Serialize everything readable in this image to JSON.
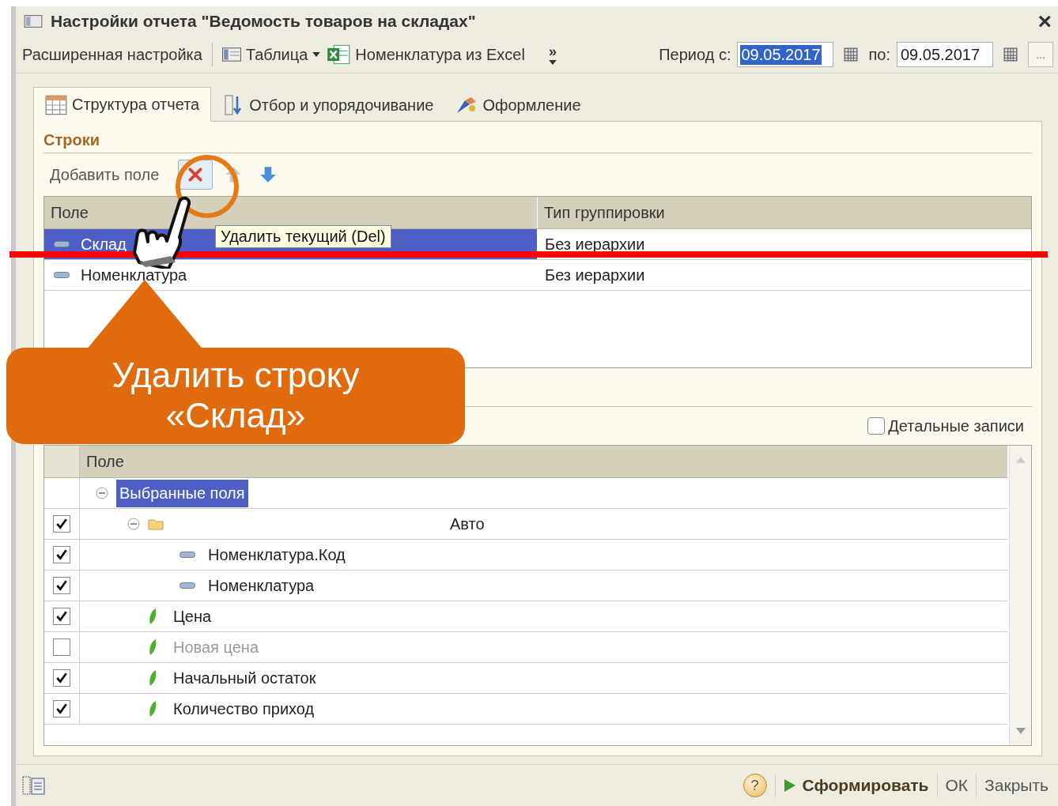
{
  "window": {
    "title": "Настройки отчета \"Ведомость товаров на складах\"",
    "close": "×"
  },
  "toolbar": {
    "items": [
      {
        "kind": "button",
        "label": "Расширенная настройка"
      },
      {
        "kind": "menu",
        "label": "Таблица"
      },
      {
        "kind": "excel",
        "label": "Номенклатура из Excel"
      },
      {
        "kind": "more",
        "label": "»"
      }
    ],
    "period": {
      "from_label": "Период с:",
      "from": "09.05.2017",
      "from_selected": true,
      "to_label": "по:",
      "to": "09.05.2017",
      "more": "..."
    }
  },
  "tabs": [
    {
      "kind": "structure",
      "label": "Структура отчета",
      "selected": true
    },
    {
      "kind": "filter",
      "label": "Отбор и упорядочивание",
      "selected": false
    },
    {
      "kind": "design",
      "label": "Оформление",
      "selected": false
    }
  ],
  "rows_section": {
    "title": "Строки",
    "add_field": "Добавить поле",
    "columns": [
      "Поле",
      "Тип группировки"
    ],
    "rows": [
      {
        "field": "Склад",
        "grouping": "Без иерархии",
        "selected": true
      },
      {
        "field": "Номенклатура",
        "grouping": "Без иерархии",
        "selected": false
      }
    ]
  },
  "details_checkbox": {
    "label": "Детальные записи",
    "checked": false
  },
  "fields_table": {
    "column": "Поле",
    "root": {
      "label": "Выбранные поля",
      "selected": true,
      "expanded": true,
      "children": [
        {
          "kind": "group",
          "checked": true,
          "expanded": true,
          "value": "Авто",
          "children": [
            {
              "kind": "field",
              "label": "Номенклатура.Код",
              "checked": true
            },
            {
              "kind": "field",
              "label": "Номенклатура",
              "checked": true
            }
          ]
        },
        {
          "kind": "resource",
          "label": "Цена",
          "checked": true
        },
        {
          "kind": "resource",
          "label": "Новая цена",
          "checked": false
        },
        {
          "kind": "resource",
          "label": "Начальный остаток",
          "checked": true
        },
        {
          "kind": "resource",
          "label": "Количество приход",
          "checked": true
        }
      ]
    }
  },
  "footer": {
    "help": "?",
    "run": "Сформировать",
    "ok": "ОК",
    "close": "Закрыть"
  },
  "tooltip": "Удалить текущий (Del)",
  "callout": [
    "Удалить строку",
    "«Склад»"
  ]
}
